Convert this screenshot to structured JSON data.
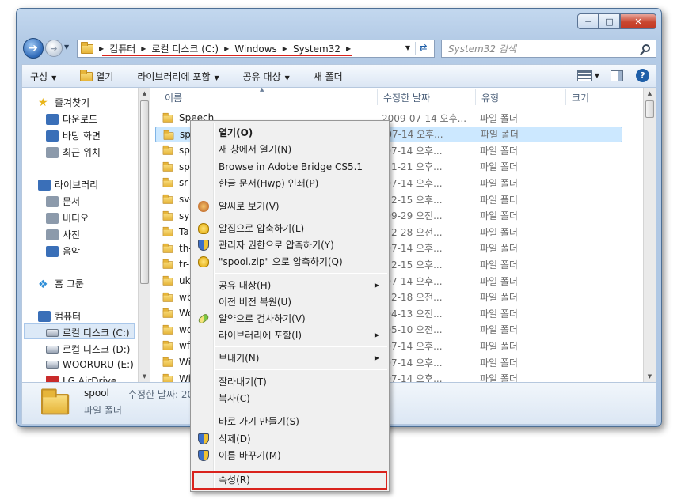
{
  "window": {
    "caption_buttons": [
      "minimize-icon",
      "maximize-icon",
      "close-icon"
    ]
  },
  "address": {
    "crumbs": [
      "컴퓨터",
      "로컬 디스크 (C:)",
      "Windows",
      "System32"
    ],
    "search_placeholder": "System32 검색"
  },
  "toolbar": {
    "organize": "구성",
    "open": "열기",
    "include_library": "라이브러리에 포함",
    "share": "공유 대상",
    "new_folder": "새 폴더"
  },
  "nav": {
    "favorites": "즐겨찾기",
    "downloads": "다운로드",
    "desktop": "바탕 화면",
    "recent": "최근 위치",
    "libraries": "라이브러리",
    "documents": "문서",
    "videos": "비디오",
    "pictures": "사진",
    "music": "음악",
    "homegroup": "홈 그룹",
    "computer": "컴퓨터",
    "drive_c": "로컬 디스크 (C:)",
    "drive_d": "로컬 디스크 (D:)",
    "drive_e": "WOORURU (E:)",
    "drive_lg": "LG AirDrive"
  },
  "columns": {
    "name": "이름",
    "modified": "수정한 날짜",
    "type": "유형",
    "size": "크기"
  },
  "files": [
    {
      "name": "Speech",
      "date": "2009-07-14 오후...",
      "type": "파일 폴더"
    },
    {
      "name": "sp",
      "date": "-07-14 오후...",
      "type": "파일 폴더"
    },
    {
      "name": "sp",
      "date": "-07-14 오후...",
      "type": "파일 폴더"
    },
    {
      "name": "sp",
      "date": "-11-21 오후...",
      "type": "파일 폴더"
    },
    {
      "name": "sr-",
      "date": "-07-14 오후...",
      "type": "파일 폴더"
    },
    {
      "name": "sv-",
      "date": "-12-15 오후...",
      "type": "파일 폴더"
    },
    {
      "name": "sys",
      "date": "-09-29 오전...",
      "type": "파일 폴더"
    },
    {
      "name": "Ta",
      "date": "-12-28 오전...",
      "type": "파일 폴더"
    },
    {
      "name": "th-",
      "date": "-07-14 오후...",
      "type": "파일 폴더"
    },
    {
      "name": "tr-",
      "date": "-12-15 오후...",
      "type": "파일 폴더"
    },
    {
      "name": "uk",
      "date": "-07-14 오후...",
      "type": "파일 폴더"
    },
    {
      "name": "wb",
      "date": "-12-18 오전...",
      "type": "파일 폴더"
    },
    {
      "name": "Wo",
      "date": "-04-13 오전...",
      "type": "파일 폴더"
    },
    {
      "name": "wc",
      "date": "-05-10 오전...",
      "type": "파일 폴더"
    },
    {
      "name": "wf",
      "date": "-07-14 오후...",
      "type": "파일 폴더"
    },
    {
      "name": "Wi",
      "date": "-07-14 오후...",
      "type": "파일 폴더"
    },
    {
      "name": "Wi",
      "date": "-07-14 오후...",
      "type": "파일 폴더"
    }
  ],
  "details": {
    "name": "spool",
    "modified": "수정한 날짜: 20",
    "type": "파일 폴더"
  },
  "context_menu": {
    "open": "열기(O)",
    "open_new_window": "새 창에서 열기(N)",
    "browse_bridge": "Browse in Adobe Bridge CS5.1",
    "hwp_print": "한글 문서(Hwp) 인쇄(P)",
    "alsee_view": "알씨로 보기(V)",
    "alzip_compress": "알집으로 압축하기(L)",
    "admin_compress": "관리자 권한으로 압축하기(Y)",
    "zip_compress": "\"spool.zip\" 으로 압축하기(Q)",
    "share": "공유 대상(H)",
    "restore_prev": "이전 버전 복원(U)",
    "alyac_scan": "알약으로 검사하기(V)",
    "include_library": "라이브러리에 포함(I)",
    "send_to": "보내기(N)",
    "cut": "잘라내기(T)",
    "copy": "복사(C)",
    "shortcut": "바로 가기 만들기(S)",
    "delete": "삭제(D)",
    "rename": "이름 바꾸기(M)",
    "properties": "속성(R)"
  },
  "colors": {
    "annotation_red": "#d9221c",
    "selection": "#cce8ff"
  }
}
